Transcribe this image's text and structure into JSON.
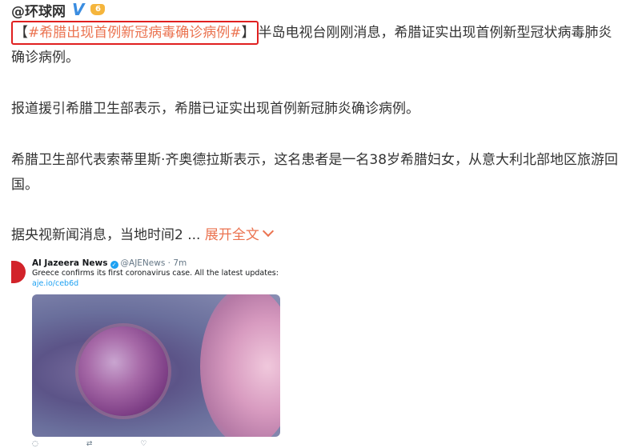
{
  "post": {
    "author": "@环球网",
    "verified_badge": "V",
    "level_badge": "6",
    "topic_open": "【",
    "topic": "#希腊出现首例新冠病毒确诊病例#",
    "topic_close": "】",
    "para1_rest": "半岛电视台刚刚消息，希腊证实出现首例新型冠状病毒肺炎确诊病例。",
    "para2": "报道援引希腊卫生部表示，希腊已证实出现首例新冠肺炎确诊病例。",
    "para3": "希腊卫生部代表索蒂里斯·齐奥德拉斯表示，这名患者是一名38岁希腊妇女，从意大利北部地区旅游回国。",
    "para4": "据央视新闻消息，当地时间2 ...",
    "expand_label": "展开全文"
  },
  "embedded_tweet": {
    "name": "Al Jazeera News",
    "handle": "@AJENews · 7m",
    "text": "Greece confirms its first coronavirus case. All the latest updates:",
    "link": "aje.io/ceb6d"
  },
  "colors": {
    "topic": "#eb7350",
    "highlight_border": "#e02020",
    "text": "#333333"
  }
}
